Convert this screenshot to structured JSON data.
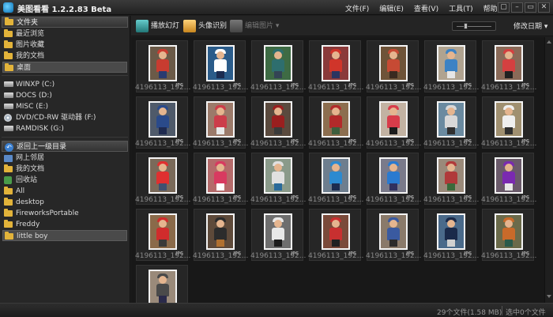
{
  "app": {
    "title": "美图看看 1.2.2.83 Beta"
  },
  "menu": [
    "文件(F)",
    "编辑(E)",
    "查看(V)",
    "工具(T)",
    "帮助(H)"
  ],
  "window_buttons": [
    "▢",
    "–",
    "▭",
    "✕"
  ],
  "sidebar": {
    "header": "文件夹",
    "quick": [
      {
        "label": "最近浏览",
        "icon": "folder-icon"
      },
      {
        "label": "图片收藏",
        "icon": "folder-icon"
      },
      {
        "label": "我的文档",
        "icon": "folder-icon"
      },
      {
        "label": "桌面",
        "icon": "folder-icon",
        "selected": true
      }
    ],
    "drives": [
      {
        "label": "WINXP (C:)",
        "icon": "drive-icon"
      },
      {
        "label": "DOCS (D:)",
        "icon": "drive-icon"
      },
      {
        "label": "MISC (E:)",
        "icon": "drive-icon"
      },
      {
        "label": "DVD/CD-RW 驱动器 (F:)",
        "icon": "dvd-icon"
      },
      {
        "label": "RAMDISK (G:)",
        "icon": "drive-icon"
      }
    ],
    "back_header": "返回上一级目录",
    "folders": [
      {
        "label": "网上邻居",
        "icon": "network-icon"
      },
      {
        "label": "我的文档",
        "icon": "folder-icon"
      },
      {
        "label": "回收站",
        "icon": "recycle-bin-icon"
      },
      {
        "label": "All",
        "icon": "folder-icon"
      },
      {
        "label": "desktop",
        "icon": "folder-icon"
      },
      {
        "label": "FireworksPortable",
        "icon": "folder-icon"
      },
      {
        "label": "Freddy",
        "icon": "folder-icon"
      },
      {
        "label": "little boy",
        "icon": "folder-icon",
        "selected": true
      }
    ]
  },
  "toolbar": {
    "slideshow": "播放幻灯",
    "face_recognition": "头像识别",
    "edit_image": "编辑图片",
    "sort": "修改日期"
  },
  "thumbnails": {
    "filename": "4196113_192...",
    "badge": "JPG",
    "count": 29,
    "palettes": [
      [
        "#6b5a48",
        "#c83c30",
        "#2a3a70"
      ],
      [
        "#2b5c8a",
        "#ffffff",
        "#1c2c50"
      ],
      [
        "#3e6b44",
        "#2e6e6e",
        "#334455"
      ],
      [
        "#8a3a3a",
        "#d0352a",
        "#2b3460"
      ],
      [
        "#6e5338",
        "#c64a34",
        "#3a2a20"
      ],
      [
        "#b0a390",
        "#3c82c4",
        "#e6e6e6"
      ],
      [
        "#8a6a58",
        "#d44040",
        "#202020"
      ],
      [
        "#4f5a6a",
        "#2a4a8a",
        "#1e2a50"
      ],
      [
        "#9b7a6a",
        "#cc3d4a",
        "#e8e8e8"
      ],
      [
        "#5a4a3e",
        "#9a1f1f",
        "#3a3a3a"
      ],
      [
        "#8c6e4f",
        "#b22a2a",
        "#3d5e3d"
      ],
      [
        "#c2b2a2",
        "#d83c4a",
        "#1c1c1c"
      ],
      [
        "#6a8aa0",
        "#d8d8d8",
        "#303030"
      ],
      [
        "#a09070",
        "#efefef",
        "#303030"
      ],
      [
        "#7a6a5a",
        "#e03030",
        "#405070"
      ],
      [
        "#b46a6a",
        "#d83a60",
        "#ffffff"
      ],
      [
        "#8a9a8a",
        "#e0e0e0",
        "#2a6a9a"
      ],
      [
        "#6e7e8e",
        "#2c8ad0",
        "#1c2c50"
      ],
      [
        "#7a7a8a",
        "#2a7ad0",
        "#303060"
      ],
      [
        "#9a8a7a",
        "#b03a3a",
        "#3a6a3a"
      ],
      [
        "#6a5a6a",
        "#7a2ab0",
        "#e8e8e8"
      ],
      [
        "#8a6a4a",
        "#d02c2c",
        "#3a3a3a"
      ],
      [
        "#5e4a3a",
        "#2c2c2c",
        "#b07030"
      ],
      [
        "#6e6e6e",
        "#e8e8e8",
        "#1c1c1c"
      ],
      [
        "#7a4a3a",
        "#c83030",
        "#202020"
      ],
      [
        "#8a7a6a",
        "#3a5aa0",
        "#2a2a2a"
      ],
      [
        "#4a6a8a",
        "#1a2a4a",
        "#d0d0d0"
      ],
      [
        "#6a6a4a",
        "#c86a2a",
        "#2a5a4a"
      ],
      [
        "#9a8a7a",
        "#4a4a4a",
        "#2a2a4a"
      ]
    ]
  },
  "status": {
    "summary": "29个文件(1.58 MB)",
    "selection": "选中0个文件"
  }
}
